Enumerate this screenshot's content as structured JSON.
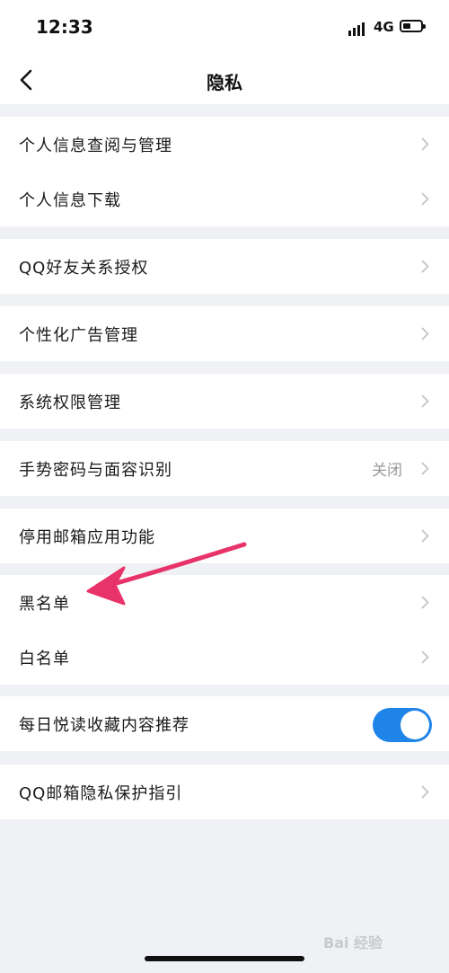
{
  "status_bar": {
    "time": "12:33",
    "network": "4G"
  },
  "nav": {
    "title": "隐私"
  },
  "groups": [
    {
      "rows": [
        {
          "label": "个人信息查阅与管理"
        },
        {
          "label": "个人信息下载"
        }
      ]
    },
    {
      "rows": [
        {
          "label": "QQ好友关系授权"
        }
      ]
    },
    {
      "rows": [
        {
          "label": "个性化广告管理"
        }
      ]
    },
    {
      "rows": [
        {
          "label": "系统权限管理"
        }
      ]
    },
    {
      "rows": [
        {
          "label": "手势密码与面容识别",
          "value": "关闭"
        }
      ]
    },
    {
      "rows": [
        {
          "label": "停用邮箱应用功能"
        }
      ]
    },
    {
      "rows": [
        {
          "label": "黑名单"
        },
        {
          "label": "白名单"
        }
      ]
    },
    {
      "rows": [
        {
          "label": "每日悦读收藏内容推荐",
          "toggle": "on"
        }
      ]
    },
    {
      "rows": [
        {
          "label": "QQ邮箱隐私保护指引"
        }
      ]
    }
  ],
  "annotation": {
    "color": "#e8336a"
  },
  "watermark": {
    "text": "Bai 经验"
  },
  "colors": {
    "accent": "#1f84e8",
    "background": "#f0f1f4"
  }
}
